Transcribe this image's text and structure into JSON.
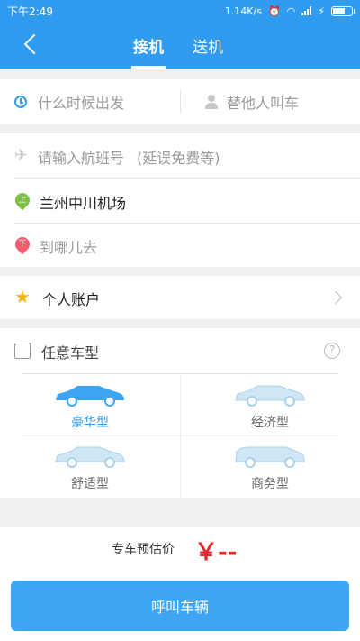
{
  "status_bar": {
    "time": "下午2:49",
    "network_speed": "1.14K/s",
    "battery_level": 0.6
  },
  "nav": {
    "back_icon": "chevron-left-icon",
    "tabs": [
      {
        "label": "接机",
        "active": true
      },
      {
        "label": "送机",
        "active": false
      }
    ]
  },
  "trip": {
    "time_placeholder": "什么时候出发",
    "proxy_call_label": "替他人叫车",
    "flight_placeholder": "请输入航班号",
    "flight_hint": "(延误免费等)",
    "pickup_badge": "上",
    "pickup_location": "兰州中川机场",
    "dropoff_badge": "下",
    "dropoff_placeholder": "到哪儿去"
  },
  "account": {
    "label": "个人账户"
  },
  "car_type": {
    "any_label": "任意车型",
    "help_symbol": "?",
    "options": [
      {
        "label": "豪华型",
        "selected": true
      },
      {
        "label": "经济型",
        "selected": false
      },
      {
        "label": "舒适型",
        "selected": false
      },
      {
        "label": "商务型",
        "selected": false
      }
    ]
  },
  "estimate": {
    "label": "专车预估价",
    "value": "￥--"
  },
  "call_button": "呼叫车辆",
  "colors": {
    "accent": "#2f9cf0",
    "price": "#e8262d",
    "car_active": "#3ea5f5",
    "car_inactive": "#cfe6f5"
  }
}
